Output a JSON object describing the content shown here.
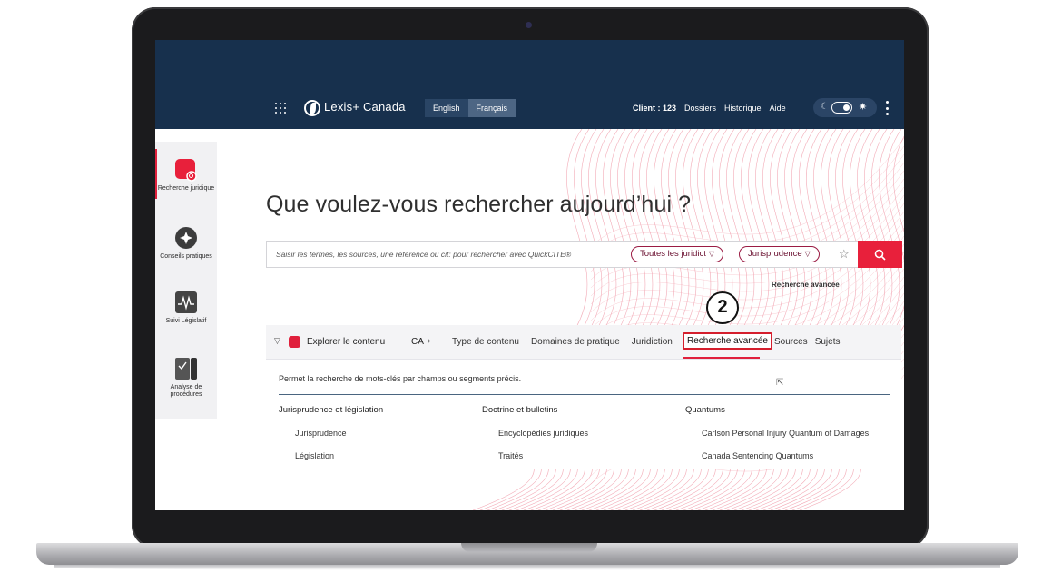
{
  "header": {
    "brand": "Lexis+ Canada",
    "languages": [
      {
        "label": "English",
        "active": false
      },
      {
        "label": "Français",
        "active": true
      }
    ],
    "client": "Client : 123",
    "links": [
      "Dossiers",
      "Historique",
      "Aide"
    ]
  },
  "sidebar": {
    "items": [
      {
        "label": "Recherche juridique",
        "icon": "legal-research-icon",
        "active": true
      },
      {
        "label": "Conseils pratiques",
        "icon": "practical-guidance-icon",
        "active": false
      },
      {
        "label": "Suivi Législatif",
        "icon": "legislative-tracking-icon",
        "active": false
      },
      {
        "label": "Analyse de procédures",
        "icon": "procedure-analysis-icon",
        "active": false
      }
    ]
  },
  "hero": {
    "title": "Que voulez-vous rechercher aujourd’hui ?"
  },
  "search": {
    "placeholder": "Saisir les termes, les sources, une référence ou cit: pour rechercher avec QuickCITE®",
    "jurisdiction_filter": "Toutes les juridict",
    "content_filter": "Jurisprudence",
    "advanced_link": "Recherche avancée"
  },
  "annotation": {
    "step": "2"
  },
  "explore": {
    "label": "Explorer le contenu",
    "region": "CA",
    "tabs": [
      "Type de contenu",
      "Domaines de pratique",
      "Juridiction"
    ],
    "active_tab": "Recherche avancée",
    "tabs_after": [
      "Sources",
      "Sujets"
    ]
  },
  "panel": {
    "description": "Permet la recherche de mots-clés par champs ou segments précis.",
    "columns": [
      {
        "heading": "Jurisprudence et législation",
        "items": [
          "Jurisprudence",
          "Législation"
        ]
      },
      {
        "heading": "Doctrine et bulletins",
        "items": [
          "Encyclopédies juridiques",
          "Traités"
        ]
      },
      {
        "heading": "Quantums",
        "items": [
          "Carlson Personal Injury Quantum of Damages",
          "Canada Sentencing Quantums"
        ]
      }
    ]
  },
  "colors": {
    "header_bg": "#17304d",
    "accent": "#e0203c",
    "pill_border": "#9b1b43"
  }
}
